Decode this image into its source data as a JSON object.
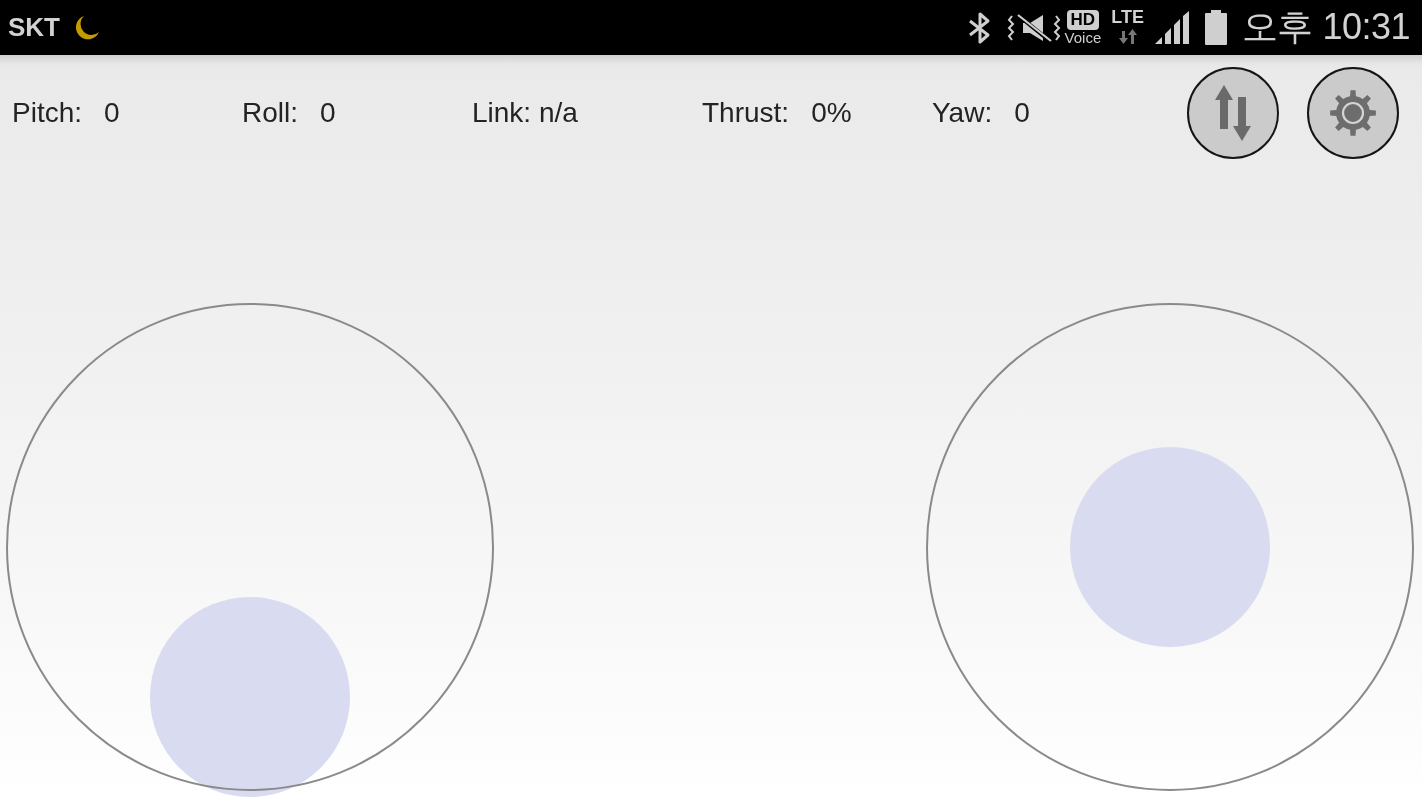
{
  "status_bar": {
    "carrier": "SKT",
    "hd_voice": {
      "badge": "HD",
      "caption": "Voice"
    },
    "network": "LTE",
    "time": "오후 10:31"
  },
  "telemetry": [
    {
      "kind": "reading",
      "label": "Pitch:",
      "value": "0"
    },
    {
      "kind": "reading",
      "label": "Roll:",
      "value": "0"
    },
    {
      "kind": "status",
      "text": "Link: n/a"
    },
    {
      "kind": "reading",
      "label": "Thrust:",
      "value": "0%"
    },
    {
      "kind": "reading",
      "label": "Yaw:",
      "value": "0"
    }
  ],
  "toolbar_buttons": [
    {
      "kind": "connect"
    },
    {
      "kind": "settings"
    }
  ],
  "joysticks": [
    {
      "kind": "throttle"
    },
    {
      "kind": "centered"
    }
  ]
}
